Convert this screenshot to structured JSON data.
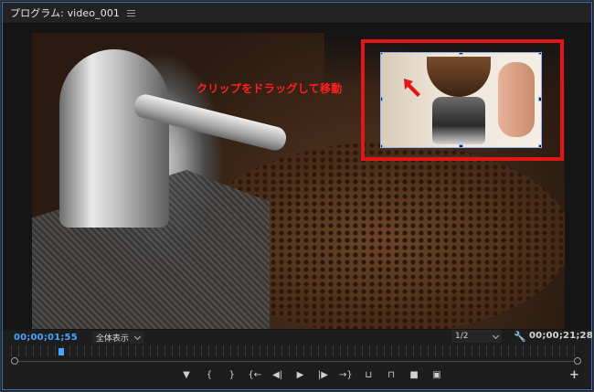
{
  "panel": {
    "title": "プログラム: video_001",
    "menu_icon": "hamburger-menu-icon"
  },
  "annotation": {
    "text": "クリップをドラッグして移動",
    "color": "#e11717"
  },
  "footer": {
    "current_time": "00;00;01;55",
    "zoom_fit": "全体表示",
    "resolution": "1/2",
    "duration": "00;00;21;28"
  },
  "transport": {
    "marker": "marker-icon",
    "mark_in": "mark-in-icon",
    "mark_out": "mark-out-icon",
    "go_to_in": "go-to-in-icon",
    "step_back": "step-back-icon",
    "play": "play-icon",
    "step_forward": "step-forward-icon",
    "go_to_out": "go-to-out-icon",
    "lift": "lift-icon",
    "extract": "extract-icon",
    "export_frame": "camera-icon",
    "compare": "comparison-view-icon",
    "add": "add-button-icon"
  },
  "colors": {
    "accent_blue": "#4aa3ff",
    "annotation_red": "#e11717",
    "panel_bg": "#1d1d1d"
  }
}
